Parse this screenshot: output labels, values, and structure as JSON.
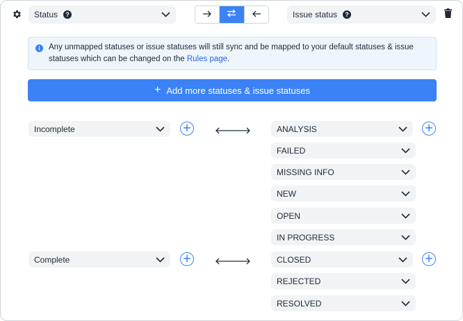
{
  "header": {
    "left_select": "Status",
    "right_select": "Issue status",
    "help_glyph": "?"
  },
  "info": {
    "icon_glyph": "i",
    "text_before": "Any unmapped statuses or issue statuses will still sync and be mapped to your default statuses & issue statuses which can be changed on the ",
    "link": "Rules page",
    "text_after": "."
  },
  "add_button": {
    "plus": "+",
    "label": "Add more statuses & issue statuses"
  },
  "mappings": [
    {
      "left": "Incomplete",
      "right": [
        "ANALYSIS",
        "FAILED",
        "MISSING INFO",
        "NEW",
        "OPEN",
        "IN PROGRESS"
      ]
    },
    {
      "left": "Complete",
      "right": [
        "CLOSED",
        "REJECTED",
        "RESOLVED"
      ]
    }
  ],
  "icons": {
    "gear": "gear-icon",
    "trash": "trash-icon",
    "direction_left_to_right": "arrow-right-icon",
    "direction_both": "arrows-swap-icon",
    "direction_right_to_left": "arrow-left-icon"
  },
  "colors": {
    "accent": "#3b82f6",
    "select_bg": "#f1f3f5",
    "info_bg": "#eef6fc",
    "link": "#2563eb"
  }
}
